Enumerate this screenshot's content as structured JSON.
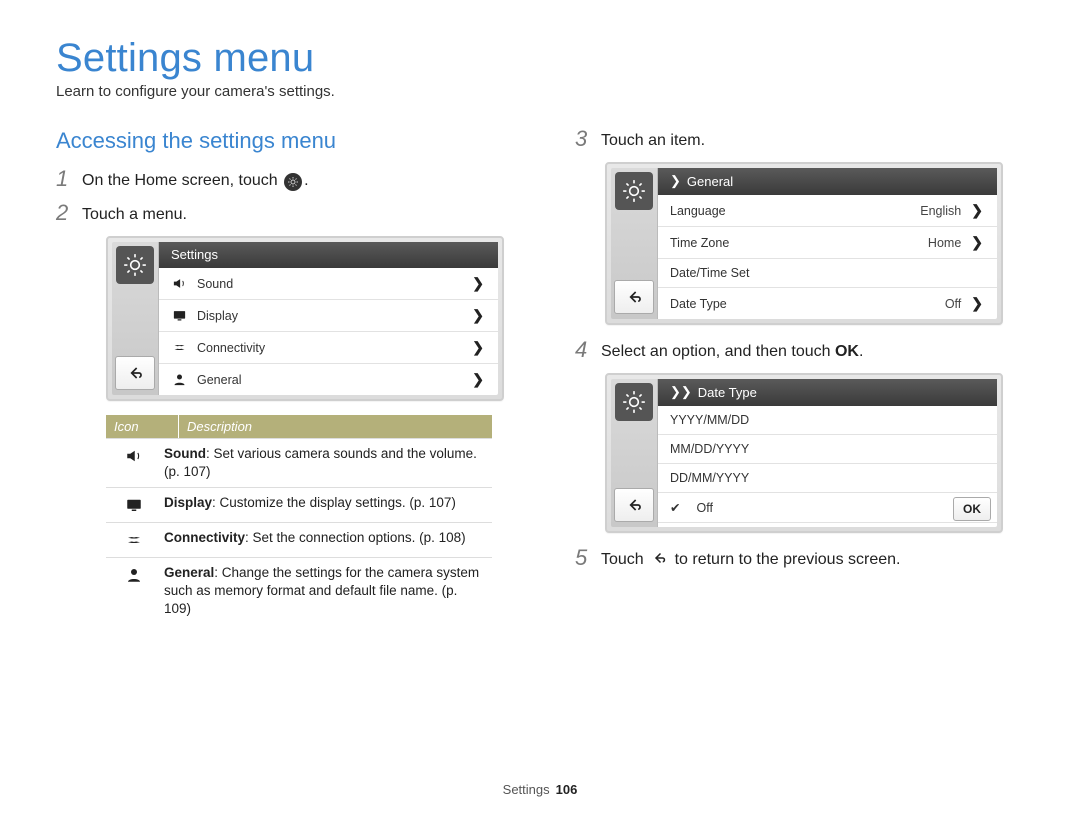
{
  "header": {
    "title": "Settings menu",
    "subtitle": "Learn to configure your camera's settings."
  },
  "left": {
    "section": "Accessing the settings menu",
    "steps": {
      "s1_pre": "On the Home screen, touch ",
      "s1_post": ".",
      "s2": "Touch a menu."
    },
    "device1": {
      "header": "Settings",
      "rows": [
        {
          "icon": "sound",
          "label": "Sound"
        },
        {
          "icon": "display",
          "label": "Display"
        },
        {
          "icon": "connectivity",
          "label": "Connectivity"
        },
        {
          "icon": "general",
          "label": "General"
        }
      ]
    },
    "table": {
      "h1": "Icon",
      "h2": "Description",
      "rows": [
        {
          "icon": "sound",
          "bold": "Sound",
          "text": ": Set various camera sounds and the volume. (p. 107)"
        },
        {
          "icon": "display",
          "bold": "Display",
          "text": ": Customize the display settings. (p. 107)"
        },
        {
          "icon": "connectivity",
          "bold": "Connectivity",
          "text": ": Set the connection options. (p. 108)"
        },
        {
          "icon": "general",
          "bold": "General",
          "text": ": Change the settings for the camera system such as memory format and default file name. (p. 109)"
        }
      ]
    }
  },
  "right": {
    "steps": {
      "s3": "Touch an item.",
      "s4_pre": "Select an option, and then touch ",
      "s4_ok": "OK",
      "s4_post": ".",
      "s5_pre": "Touch ",
      "s5_post": " to return to the previous screen."
    },
    "device2": {
      "header": "General",
      "rows": [
        {
          "label": "Language",
          "value": "English",
          "chev": true
        },
        {
          "label": "Time Zone",
          "value": "Home",
          "chev": true
        },
        {
          "label": "Date/Time Set",
          "value": "",
          "chev": false
        },
        {
          "label": "Date Type",
          "value": "Off",
          "chev": true
        }
      ]
    },
    "device3": {
      "header": "Date Type",
      "rows": [
        {
          "label": "YYYY/MM/DD",
          "checked": false
        },
        {
          "label": "MM/DD/YYYY",
          "checked": false
        },
        {
          "label": "DD/MM/YYYY",
          "checked": false
        },
        {
          "label": "Off",
          "checked": true
        }
      ],
      "ok": "OK"
    }
  },
  "footer": {
    "section": "Settings",
    "page": "106"
  }
}
